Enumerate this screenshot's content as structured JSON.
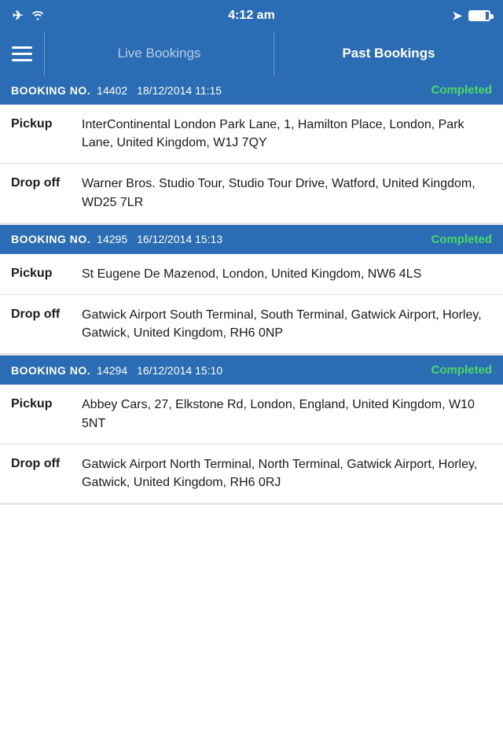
{
  "statusBar": {
    "time": "4:12 am",
    "airplaneMode": "✈",
    "wifi": "wifi"
  },
  "navBar": {
    "liveBookings": "Live Bookings",
    "pastBookings": "Past Bookings"
  },
  "bookings": [
    {
      "id": "booking-1",
      "label": "BOOKING NO.",
      "number": "14402",
      "date": "18/12/2014 11:15",
      "status": "Completed",
      "pickup": {
        "label": "Pickup",
        "address": "InterContinental London Park Lane, 1, Hamilton Place, London, Park Lane, United Kingdom, W1J 7QY"
      },
      "dropoff": {
        "label": "Drop off",
        "address": "Warner Bros. Studio Tour, Studio Tour Drive, Watford, United Kingdom, WD25 7LR"
      }
    },
    {
      "id": "booking-2",
      "label": "BOOKING NO.",
      "number": "14295",
      "date": "16/12/2014 15:13",
      "status": "Completed",
      "pickup": {
        "label": "Pickup",
        "address": "St Eugene De Mazenod, London, United Kingdom, NW6 4LS"
      },
      "dropoff": {
        "label": "Drop off",
        "address": "Gatwick Airport South Terminal, South Terminal, Gatwick Airport, Horley, Gatwick, United Kingdom, RH6 0NP"
      }
    },
    {
      "id": "booking-3",
      "label": "BOOKING NO.",
      "number": "14294",
      "date": "16/12/2014 15:10",
      "status": "Completed",
      "pickup": {
        "label": "Pickup",
        "address": "Abbey Cars, 27, Elkstone Rd, London, England, United Kingdom, W10 5NT"
      },
      "dropoff": {
        "label": "Drop off",
        "address": "Gatwick Airport North Terminal, North Terminal, Gatwick Airport, Horley, Gatwick, United Kingdom, RH6 0RJ"
      }
    }
  ]
}
